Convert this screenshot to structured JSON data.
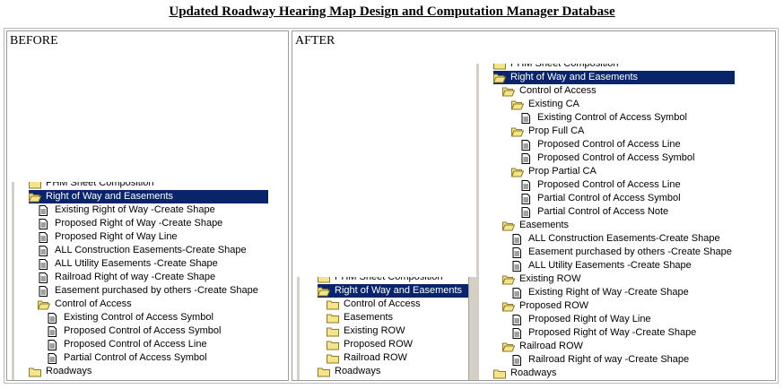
{
  "title": "Updated Roadway Hearing Map Design and Computation Manager Database",
  "before": {
    "label": "BEFORE",
    "items": [
      {
        "label": "PHM Sheet Composition",
        "icon": "folder-closed",
        "level": 1
      },
      {
        "label": "Right of Way and Easements",
        "icon": "folder-open",
        "level": 1,
        "selected": true
      },
      {
        "label": "Existing Right of Way -Create Shape",
        "icon": "document",
        "level": 2
      },
      {
        "label": "Proposed Right of Way -Create Shape",
        "icon": "document",
        "level": 2
      },
      {
        "label": "Proposed Right of Way Line",
        "icon": "document",
        "level": 2
      },
      {
        "label": "ALL Construction Easements-Create Shape",
        "icon": "document",
        "level": 2
      },
      {
        "label": "ALL Utility Easements -Create Shape",
        "icon": "document",
        "level": 2
      },
      {
        "label": "Railroad Right of way -Create Shape",
        "icon": "document",
        "level": 2
      },
      {
        "label": "Easement purchased by others -Create Shape",
        "icon": "document",
        "level": 2
      },
      {
        "label": "Control of Access",
        "icon": "folder-open",
        "level": 2
      },
      {
        "label": "Existing  Control of Access Symbol",
        "icon": "document",
        "level": 3
      },
      {
        "label": "Proposed Control of Access Symbol",
        "icon": "document",
        "level": 3
      },
      {
        "label": "Proposed Control of Access Line",
        "icon": "document",
        "level": 3
      },
      {
        "label": "Partial Control of Access Symbol",
        "icon": "document",
        "level": 3
      },
      {
        "label": "Roadways",
        "icon": "folder-closed",
        "level": 1
      }
    ]
  },
  "after": {
    "label": "AFTER",
    "collapsed_items": [
      {
        "label": "PHM Sheet Composition",
        "icon": "folder-closed",
        "level": 1
      },
      {
        "label": "Right of Way and Easements",
        "icon": "folder-open",
        "level": 1,
        "selected": true
      },
      {
        "label": "Control of Access",
        "icon": "folder-closed",
        "level": 2
      },
      {
        "label": "Easements",
        "icon": "folder-closed",
        "level": 2
      },
      {
        "label": "Existing ROW",
        "icon": "folder-closed",
        "level": 2
      },
      {
        "label": "Proposed ROW",
        "icon": "folder-closed",
        "level": 2
      },
      {
        "label": "Railroad ROW",
        "icon": "folder-closed",
        "level": 2
      },
      {
        "label": "Roadways",
        "icon": "folder-closed",
        "level": 1
      }
    ],
    "expanded_items": [
      {
        "label": "PHM Sheet Composition",
        "icon": "folder-closed",
        "level": 1
      },
      {
        "label": "Right of Way and Easements",
        "icon": "folder-open",
        "level": 1,
        "selected": true
      },
      {
        "label": "Control of Access",
        "icon": "folder-open",
        "level": 2
      },
      {
        "label": "Existing CA",
        "icon": "folder-open",
        "level": 3
      },
      {
        "label": "Existing  Control of Access Symbol",
        "icon": "document",
        "level": 4
      },
      {
        "label": "Prop Full CA",
        "icon": "folder-open",
        "level": 3
      },
      {
        "label": "Proposed Control of Access Line",
        "icon": "document",
        "level": 4
      },
      {
        "label": "Proposed Control of Access Symbol",
        "icon": "document",
        "level": 4
      },
      {
        "label": "Prop Partial CA",
        "icon": "folder-open",
        "level": 3
      },
      {
        "label": "Proposed Control of Access Line",
        "icon": "document",
        "level": 4
      },
      {
        "label": "Partial Control of Access Symbol",
        "icon": "document",
        "level": 4
      },
      {
        "label": "Partial Control of Access Note",
        "icon": "document",
        "level": 4
      },
      {
        "label": "Easements",
        "icon": "folder-open",
        "level": 2
      },
      {
        "label": "ALL Construction Easements-Create Shape",
        "icon": "document",
        "level": 3
      },
      {
        "label": "Easement purchased by others -Create Shape",
        "icon": "document",
        "level": 3
      },
      {
        "label": "ALL Utility Easements -Create Shape",
        "icon": "document",
        "level": 3
      },
      {
        "label": "Existing ROW",
        "icon": "folder-open",
        "level": 2
      },
      {
        "label": "Existing Right of Way -Create Shape",
        "icon": "document",
        "level": 3
      },
      {
        "label": "Proposed ROW",
        "icon": "folder-open",
        "level": 2
      },
      {
        "label": "Proposed Right of Way Line",
        "icon": "document",
        "level": 3
      },
      {
        "label": "Proposed Right of Way -Create Shape",
        "icon": "document",
        "level": 3
      },
      {
        "label": "Railroad ROW",
        "icon": "folder-open",
        "level": 2
      },
      {
        "label": "Railroad Right of way -Create Shape",
        "icon": "document",
        "level": 3
      },
      {
        "label": "Roadways",
        "icon": "folder-closed",
        "level": 1
      }
    ]
  },
  "colors": {
    "selection": "#0a246a",
    "folder": "#f4e58c",
    "folder_border": "#8a7a2a"
  }
}
